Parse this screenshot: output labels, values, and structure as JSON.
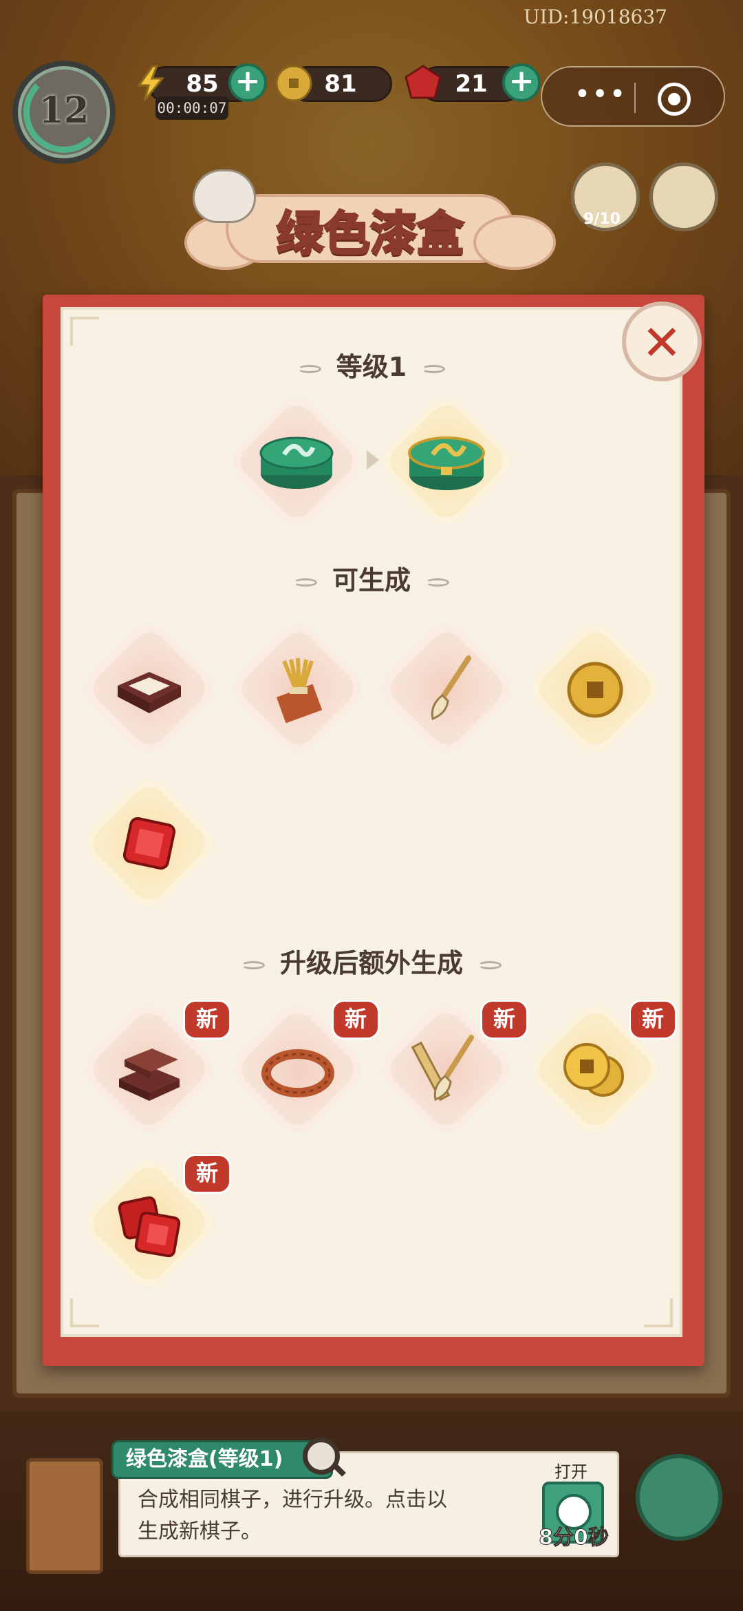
{
  "hud": {
    "uid": "UID:19018637",
    "player_level": "12",
    "energy": "85",
    "energy_timer": "00:00:07",
    "coins": "81",
    "gems": "21",
    "side_progress": "9/10"
  },
  "banner": {
    "title": "绿色漆盒"
  },
  "modal": {
    "level_title": "等级1",
    "can_generate_title": "可生成",
    "upgrade_title": "升级后额外生成",
    "new_badge": "新",
    "current_items": [
      {
        "name": "green-lacquer-box-level-1-icon"
      },
      {
        "name": "green-lacquer-box-level-2-icon"
      }
    ],
    "generate_items": [
      {
        "name": "ink-box-icon"
      },
      {
        "name": "straw-bundle-icon"
      },
      {
        "name": "brush-icon"
      },
      {
        "name": "copper-coin-icon"
      },
      {
        "name": "red-gem-icon"
      }
    ],
    "upgrade_items": [
      {
        "name": "brown-box-icon"
      },
      {
        "name": "rope-coil-icon"
      },
      {
        "name": "ruler-and-brush-icon"
      },
      {
        "name": "coins-pair-icon"
      },
      {
        "name": "gems-pair-icon"
      }
    ]
  },
  "info": {
    "item_name": "绿色漆盒(等级1)",
    "line1": "合成相同棋子，进行升级。点击以",
    "line2": "生成新棋子。",
    "open_label": "打开",
    "open_time": "8分0秒"
  },
  "colors": {
    "frame_red": "#c8473c",
    "paper": "#f7f1e4",
    "accent_green": "#2f8a6c",
    "badge_red": "#c0392b"
  }
}
